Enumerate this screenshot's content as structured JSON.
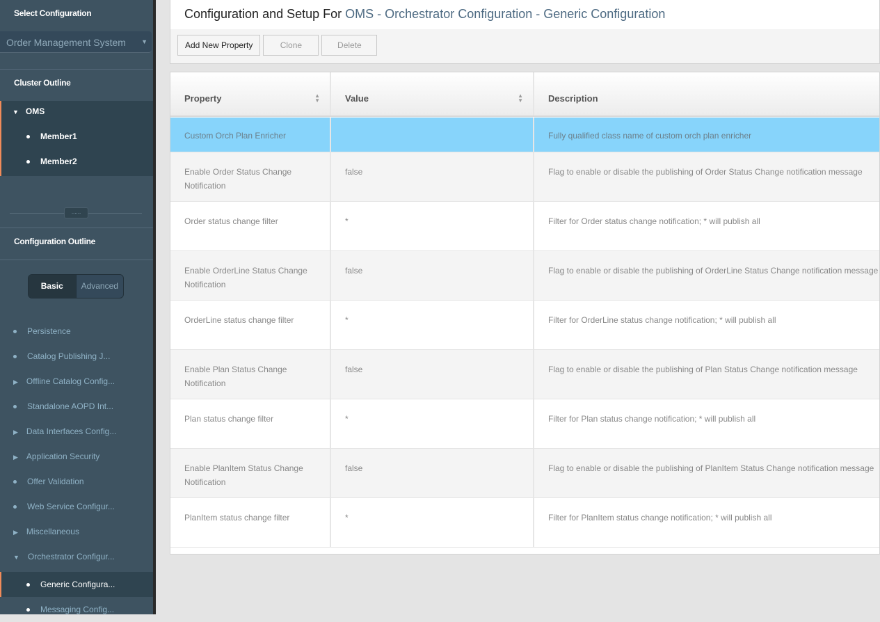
{
  "sidebar": {
    "select_title": "Select Configuration",
    "selected_config": "Order Management System",
    "cluster_title": "Cluster Outline",
    "cluster_root": "OMS",
    "members": [
      "Member1",
      "Member2"
    ],
    "splitter": "......",
    "config_title": "Configuration Outline",
    "toggle": {
      "basic": "Basic",
      "advanced": "Advanced"
    },
    "nav": [
      "Persistence",
      "Catalog Publishing J...",
      "Offline Catalog Config...",
      "Standalone AOPD Int...",
      "Data Interfaces Config...",
      "Application Security",
      "Offer Validation",
      "Web Service Configur...",
      "Miscellaneous",
      "Orchestrator Configur..."
    ],
    "sub_nav": [
      "Generic Configura...",
      "Messaging Config..."
    ]
  },
  "header": {
    "prefix": "Configuration and Setup For",
    "path": "OMS - Orchestrator Configuration - Generic Configuration"
  },
  "toolbar": {
    "add": "Add New Property",
    "clone": "Clone",
    "delete": "Delete"
  },
  "table": {
    "columns": [
      "Property",
      "Value",
      "Description"
    ],
    "rows": [
      {
        "property": "Custom Orch Plan Enricher",
        "value": "",
        "description": "Fully qualified class name of custom orch plan enricher"
      },
      {
        "property": "Enable Order Status Change Notification",
        "value": "false",
        "description": "Flag to enable or disable the publishing of Order Status Change notification message"
      },
      {
        "property": "Order status change filter",
        "value": "*",
        "description": "Filter for Order status change notification; * will publish all"
      },
      {
        "property": "Enable OrderLine Status Change Notification",
        "value": "false",
        "description": "Flag to enable or disable the publishing of OrderLine Status Change notification message"
      },
      {
        "property": "OrderLine status change filter",
        "value": "*",
        "description": "Filter for OrderLine status change notification; * will publish all"
      },
      {
        "property": "Enable Plan Status Change Notification",
        "value": "false",
        "description": "Flag to enable or disable the publishing of Plan Status Change notification message"
      },
      {
        "property": "Plan status change filter",
        "value": "*",
        "description": "Filter for Plan status change notification; * will publish all"
      },
      {
        "property": "Enable PlanItem Status Change Notification",
        "value": "false",
        "description": "Flag to enable or disable the publishing of PlanItem Status Change notification message"
      },
      {
        "property": "PlanItem status change filter",
        "value": "*",
        "description": "Filter for PlanItem status change notification; * will publish all"
      }
    ]
  }
}
